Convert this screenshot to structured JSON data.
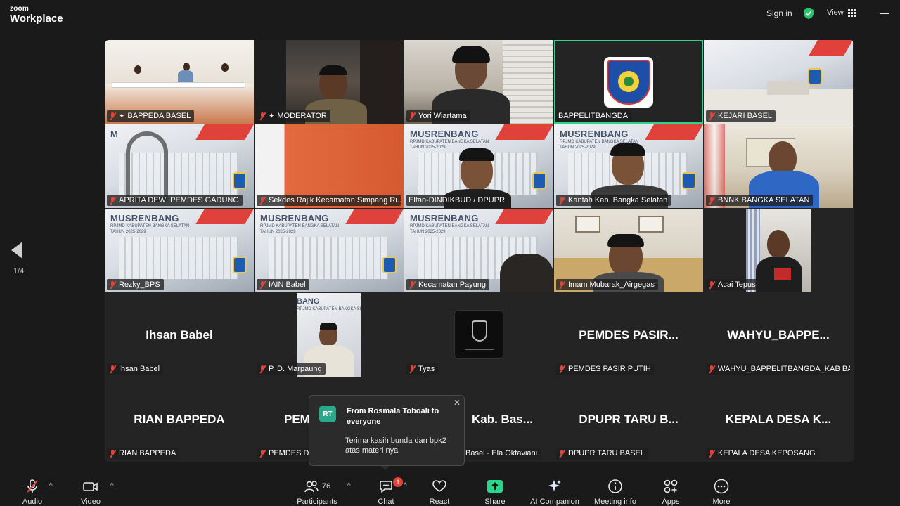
{
  "app": {
    "brand_top": "zoom",
    "brand_bottom": "Workplace"
  },
  "topbar": {
    "signin": "Sign in",
    "view": "View"
  },
  "pagination": {
    "label": "1/4"
  },
  "tiles": [
    {
      "name": "BAPPEDA BASEL",
      "pinned": true
    },
    {
      "name": "MODERATOR",
      "pinned": true
    },
    {
      "name": "Yori Wiartama"
    },
    {
      "name": "BAPPELITBANGDA"
    },
    {
      "name": "KEJARI BASEL"
    },
    {
      "name": "APRITA DEWI PEMDES GADUNG"
    },
    {
      "name": "Sekdes Rajik Kecamatan Simpang Ri..."
    },
    {
      "name": "Elfan-DINDIKBUD / DPUPR"
    },
    {
      "name": "Kantah Kab. Bangka Selatan"
    },
    {
      "name": "BNNK BANGKA SELATAN"
    },
    {
      "name": "Rezky_BPS"
    },
    {
      "name": "IAIN Babel"
    },
    {
      "name": "Kecamatan Payung"
    },
    {
      "name": "Imam Mubarak_Airgegas"
    },
    {
      "name": "Acai Tepus"
    },
    {
      "name": "Ihsan Babel",
      "display": "Ihsan Babel"
    },
    {
      "name": "P. D. Marpaung"
    },
    {
      "name": "Tyas"
    },
    {
      "name": "PEMDES PASIR PUTIH",
      "display": "PEMDES PASIR..."
    },
    {
      "name": "WAHYU_BAPPELITBANGDA_KAB BAS...",
      "display": "WAHYU_BAPPE..."
    },
    {
      "name": "RIAN BAPPEDA",
      "display": "RIAN BAPPEDA"
    },
    {
      "name": "PEMDES D",
      "display": "PEM"
    },
    {
      "name": "Basel - Ela Oktaviani",
      "display": "Kab. Bas..."
    },
    {
      "name": "DPUPR TARU BASEL",
      "display": "DPUPR TARU B..."
    },
    {
      "name": "KEPALA DESA KEPOSANG",
      "display": "KEPALA DESA K..."
    }
  ],
  "slide": {
    "title": "MUSRENBANG",
    "title_short": "BANG",
    "subtitle": "RPJMD KABUPATEN BANGKA SELATAN",
    "year": "TAHUN 2025-2029"
  },
  "toast": {
    "avatar": "RT",
    "from": "From Rosmala Toboali to everyone",
    "message": "Terima kasih bunda dan bpk2 atas materi nya",
    "close": "✕"
  },
  "toolbar": {
    "audio": "Audio",
    "video": "Video",
    "participants": "Participants",
    "participants_count": "76",
    "chat": "Chat",
    "chat_badge": "1",
    "react": "React",
    "share": "Share",
    "ai": "AI Companion",
    "meeting_info": "Meeting info",
    "apps": "Apps",
    "more": "More"
  },
  "colors": {
    "active_speaker": "#2bd48a",
    "share_green": "#2bd48a",
    "mute_red": "#e0453a",
    "badge_red": "#e0453a"
  }
}
